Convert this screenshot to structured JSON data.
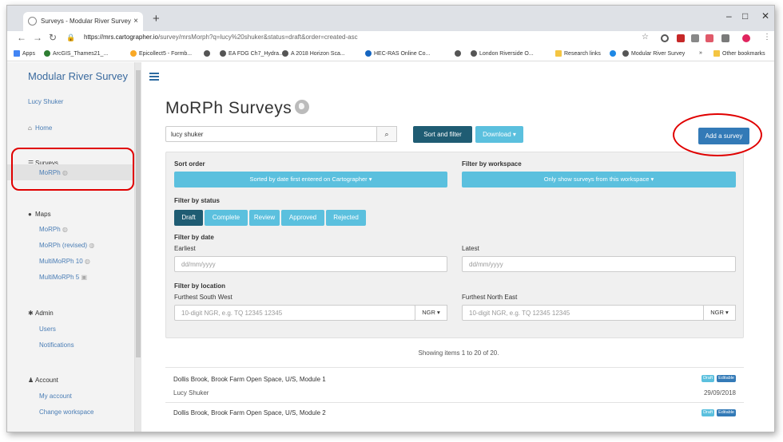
{
  "browser": {
    "tab_title": "Surveys - Modular River Survey",
    "tab_close": "×",
    "new_tab": "+",
    "url_host": "https://mrs.cartographer.io",
    "url_path": "/survey/mrsMorph?q=lucy%20shuker&status=draft&order=created-asc",
    "bookmarks": [
      "Apps",
      "ArcGIS_Thames21_...",
      "Epicollect5 - Formb...",
      "EA FDG Ch7_Hydra...",
      "A 2018 Horizon Sca...",
      "HEC-RAS Online Co...",
      "London Riverside O...",
      "Research links",
      "Modular River Survey",
      "»",
      "Other bookmarks"
    ]
  },
  "sidebar": {
    "brand": "Modular River Survey",
    "user": "Lucy Shuker",
    "home": "Home",
    "surveys_heading": "Surveys",
    "surveys_item": "MoRPh",
    "maps_heading": "Maps",
    "maps_items": [
      "MoRPh",
      "MoRPh (revised)",
      "MultiMoRPh 10",
      "MultiMoRPh 5"
    ],
    "admin_heading": "Admin",
    "admin_items": [
      "Users",
      "Notifications"
    ],
    "account_heading": "Account",
    "account_items": [
      "My account",
      "Change workspace"
    ]
  },
  "main": {
    "title": "MoRPh Surveys",
    "search_value": "lucy shuker",
    "sort_filter_label": "Sort and filter",
    "download_label": "Download ▾",
    "add_label": "Add a survey",
    "sort_order_label": "Sort order",
    "sort_order_value": "Sorted by date first entered on Cartographer ▾",
    "filter_workspace_label": "Filter by workspace",
    "filter_workspace_value": "Only show surveys from this workspace ▾",
    "filter_status_label": "Filter by status",
    "statuses": [
      "Draft",
      "Complete",
      "Review",
      "Approved",
      "Rejected"
    ],
    "filter_date_label": "Filter by date",
    "earliest_label": "Earliest",
    "latest_label": "Latest",
    "date_placeholder": "dd/mm/yyyy",
    "filter_location_label": "Filter by location",
    "sw_label": "Furthest South West",
    "ne_label": "Furthest North East",
    "ngr_placeholder": "10-digit NGR, e.g. TQ 12345 12345",
    "ngr_button": "NGR ▾",
    "showing": "Showing items 1 to 20 of 20.",
    "rows": [
      {
        "title": "Dollis Brook, Brook Farm Open Space, U/S, Module 1",
        "author": "Lucy Shuker",
        "date": "29/09/2018",
        "badge1": "Draft",
        "badge2": "Editable"
      },
      {
        "title": "Dollis Brook, Brook Farm Open Space, U/S, Module 2",
        "badge1": "Draft",
        "badge2": "Editable"
      }
    ]
  },
  "colors": {
    "accent": "#5bc0de",
    "dark_button": "#1f5c73",
    "primary": "#337ab7",
    "highlight_ring": "#e00000"
  }
}
